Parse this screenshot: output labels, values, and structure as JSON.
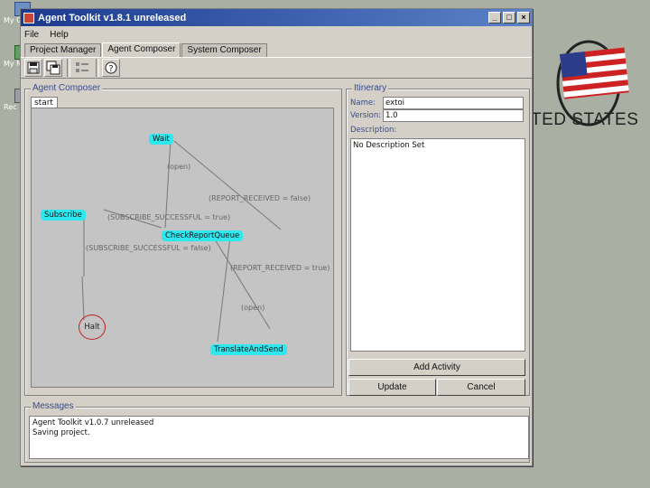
{
  "desktop": {
    "icons": [
      {
        "label": "My C",
        "icon": "computer-icon"
      },
      {
        "label": "My N",
        "icon": "network-icon"
      },
      {
        "label": "Rec",
        "icon": "recycle-bin-icon"
      }
    ]
  },
  "logo": {
    "text": "TED STATES",
    "icon": "us-flag-icon"
  },
  "window": {
    "title": "Agent Toolkit v1.8.1 unreleased",
    "controls": [
      "_",
      "□",
      "×"
    ],
    "menu": [
      "File",
      "Help"
    ],
    "tabs": [
      {
        "label": "Project Manager",
        "active": false
      },
      {
        "label": "Agent Composer",
        "active": true
      },
      {
        "label": "System Composer",
        "active": false
      }
    ],
    "toolbar": [
      {
        "icon": "save-icon"
      },
      {
        "icon": "save-as-icon"
      },
      {
        "icon": "list-icon"
      },
      {
        "icon": "help-icon"
      }
    ]
  },
  "composer": {
    "title": "Agent Composer",
    "canvas_tab": "start",
    "nodes": {
      "wait": "Wait",
      "subscribe": "Subscribe",
      "check": "CheckReportQueue",
      "halt": "Halt",
      "translate": "TranslateAndSend"
    },
    "edges": {
      "open1": "(open)",
      "report_false": "(REPORT_RECEIVED = false)",
      "sub_true": "(SUBSCRIBE_SUCCESSFUL = true)",
      "sub_false": "(SUBSCRIBE_SUCCESSFUL = false)",
      "report_true": "(REPORT_RECEIVED = true)",
      "open2": "(open)"
    }
  },
  "itinerary": {
    "title": "Itinerary",
    "name_label": "Name:",
    "name_value": "extoi",
    "version_label": "Version:",
    "version_value": "1.0",
    "description_label": "Description:",
    "description_value": "No Description Set",
    "add_activity": "Add Activity",
    "update": "Update",
    "cancel": "Cancel"
  },
  "messages": {
    "title": "Messages",
    "lines": [
      "Agent Toolkit v1.0.7 unreleased",
      "Saving project."
    ]
  },
  "colors": {
    "node": "#2ee8f0",
    "halt_border": "#c02020",
    "title_bar": "#1c3a8e"
  }
}
